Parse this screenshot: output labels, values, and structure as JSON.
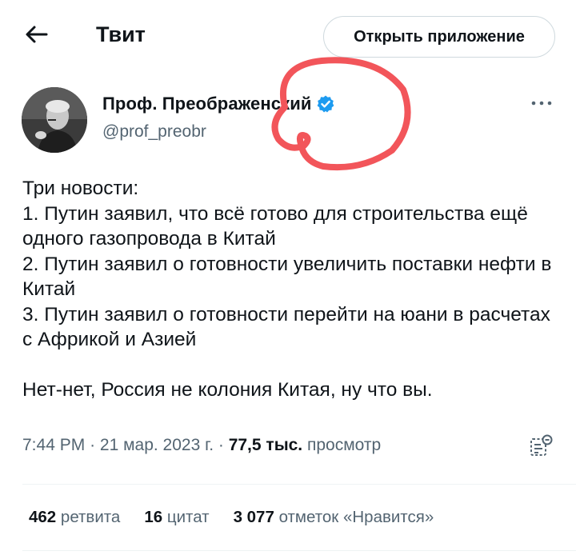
{
  "header": {
    "title": "Твит",
    "open_app_label": "Открыть приложение"
  },
  "author": {
    "name": "Проф. Преображенский",
    "handle": "@prof_preobr",
    "verified": true,
    "badge_color": "#1d9bf0"
  },
  "tweet": {
    "text": "Три новости:\n1. Путин заявил, что всё готово для строительства ещё одного газопровода в Китай\n2. Путин заявил о готовности увеличить поставки нефти в Китай\n3. Путин заявил о готовности перейти на юани в расчетах с Африкой и Азией\n\nНет-нет, Россия не колония Китая, ну что вы.",
    "time": "7:44 PM",
    "date": "21 мар. 2023 г.",
    "views_count": "77,5 тыс.",
    "views_label": "просмотр"
  },
  "stats": {
    "retweets_count": "462",
    "retweets_label": "ретвита",
    "quotes_count": "16",
    "quotes_label": "цитат",
    "likes_count": "3 077",
    "likes_label": "отметок «Нравится»"
  },
  "icons": {
    "back": "arrow-left-icon",
    "more": "more-horizontal-icon",
    "analytics": "analytics-icon",
    "verified": "verified-badge-icon"
  },
  "colors": {
    "text": "#0f1419",
    "secondary": "#536471",
    "border": "#cfd9de",
    "scribble": "#f2555a"
  }
}
